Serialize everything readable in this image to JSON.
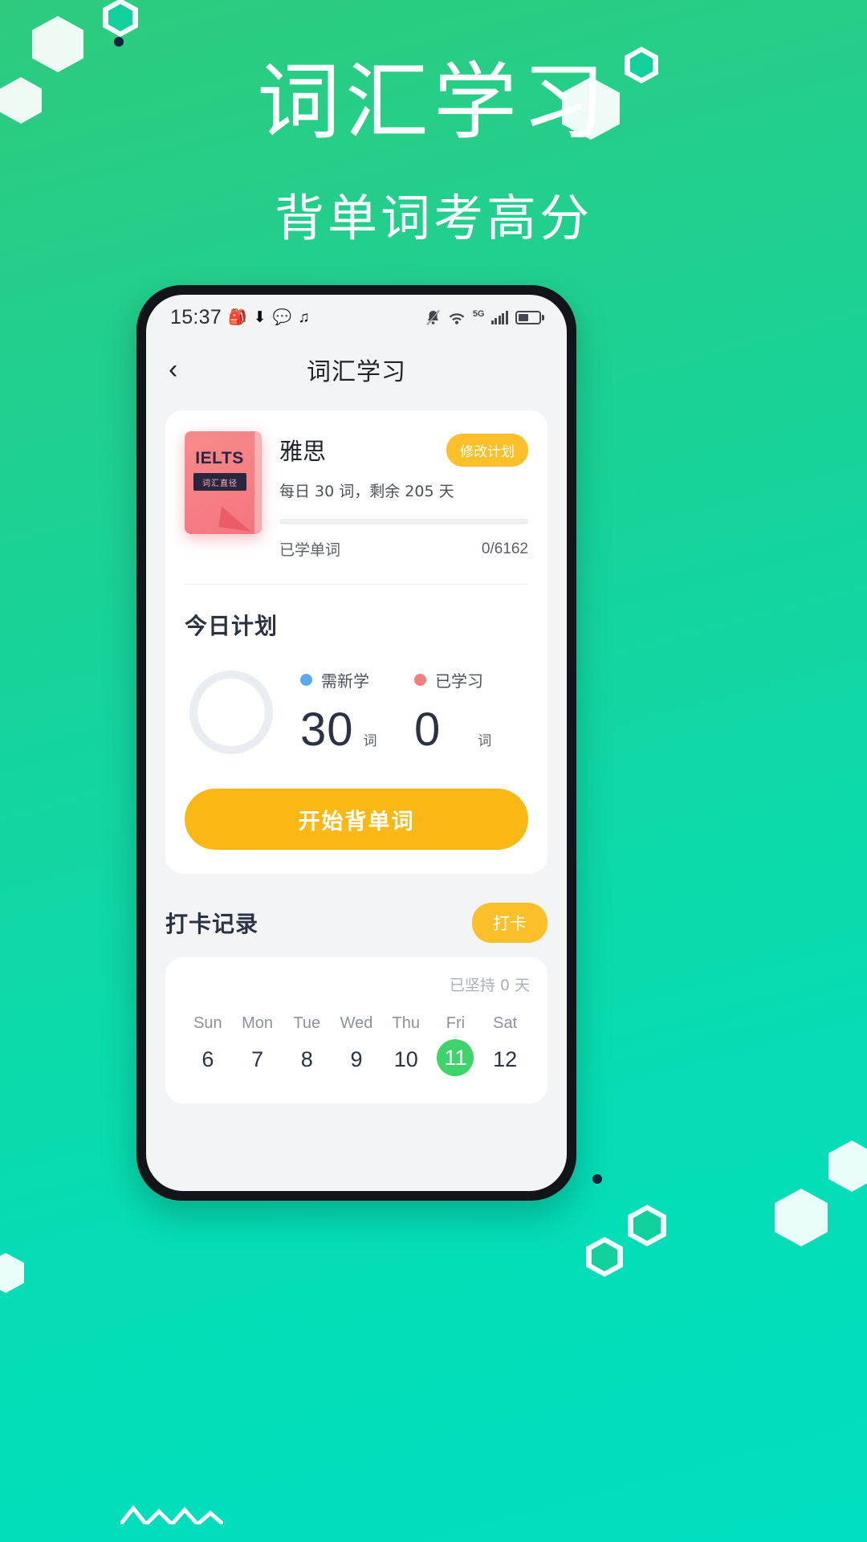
{
  "poster": {
    "headline": "词汇学习",
    "subhead": "背单词考高分",
    "bg_gradient_from": "#2ECB7E",
    "bg_gradient_to": "#00DFC0"
  },
  "statusbar": {
    "time": "15:37",
    "left_icons": [
      "🎒",
      "⬇",
      "💬",
      "♫"
    ],
    "network_label": "5G",
    "icons": [
      "bell-mute-icon",
      "wifi-icon",
      "signal-icon",
      "battery-icon"
    ]
  },
  "nav": {
    "back_icon": "‹",
    "title": "词汇学习"
  },
  "book_card": {
    "cover": {
      "brand": "IELTS",
      "subtitle": "词汇直径",
      "color": "#F2757D"
    },
    "title": "雅思",
    "plan_badge": "修改计划",
    "meta": "每日 30 词，剩余 205 天",
    "progress_percent": 0,
    "learned_label": "已学单词",
    "learned_value": "0/6162"
  },
  "today_plan": {
    "title": "今日计划",
    "stats": [
      {
        "label": "需新学",
        "value": "30",
        "unit": "词",
        "dot_color": "#5EA8F0"
      },
      {
        "label": "已学习",
        "value": "0",
        "unit": "词",
        "dot_color": "#F4807E"
      }
    ],
    "cta": "开始背单词"
  },
  "checkin": {
    "title": "打卡记录",
    "button": "打卡",
    "streak": "已坚持 0 天",
    "days": [
      {
        "name": "Sun",
        "num": "6",
        "today": false
      },
      {
        "name": "Mon",
        "num": "7",
        "today": false
      },
      {
        "name": "Tue",
        "num": "8",
        "today": false
      },
      {
        "name": "Wed",
        "num": "9",
        "today": false
      },
      {
        "name": "Thu",
        "num": "10",
        "today": false
      },
      {
        "name": "Fri",
        "num": "11",
        "today": true
      },
      {
        "name": "Sat",
        "num": "12",
        "today": false
      }
    ],
    "today_color": "#3FD36C"
  }
}
